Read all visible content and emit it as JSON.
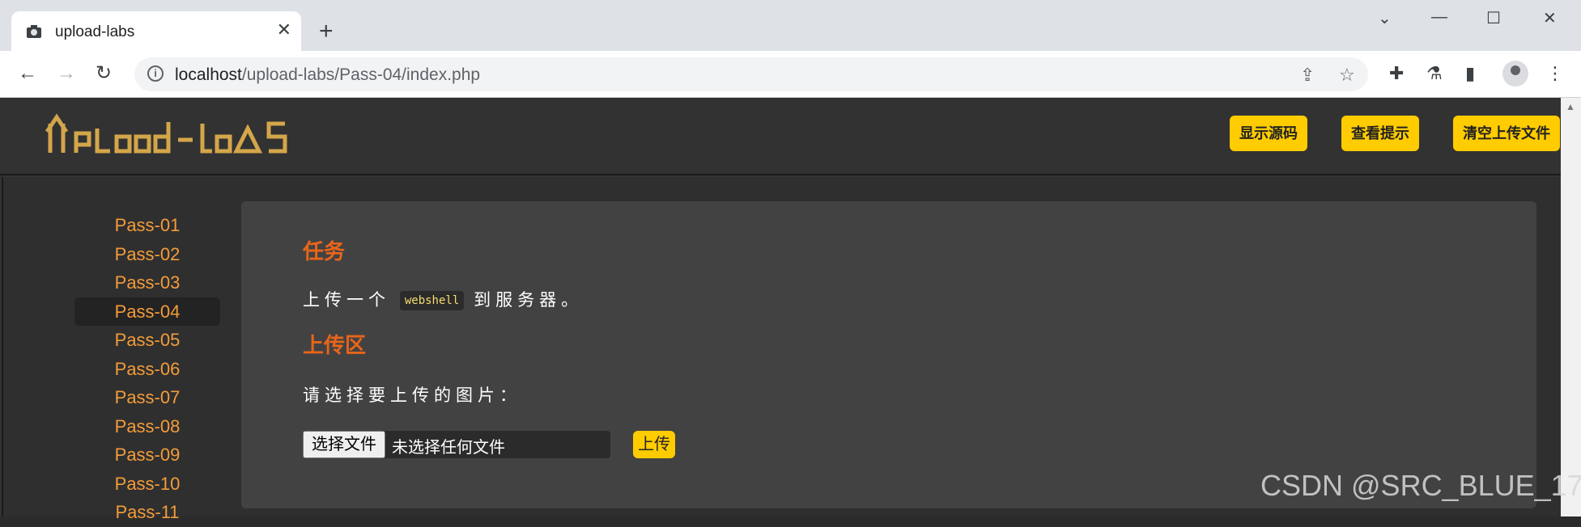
{
  "browser": {
    "tab_title": "upload-labs",
    "tab_close": "✕",
    "new_tab": "+",
    "url_host": "localhost",
    "url_path": "/upload-labs/Pass-04/index.php"
  },
  "header": {
    "logo_text": "UpLoad-LabS",
    "buttons": [
      "显示源码",
      "查看提示",
      "清空上传文件"
    ]
  },
  "sidebar": {
    "items": [
      "Pass-01",
      "Pass-02",
      "Pass-03",
      "Pass-04",
      "Pass-05",
      "Pass-06",
      "Pass-07",
      "Pass-08",
      "Pass-09",
      "Pass-10",
      "Pass-11"
    ],
    "active": "Pass-04"
  },
  "content": {
    "task_heading": "任务",
    "task_text_before": "上传一个",
    "task_code": "webshell",
    "task_text_after": "到服务器。",
    "upload_heading": "上传区",
    "upload_prompt": "请选择要上传的图片：",
    "file_button": "选择文件",
    "file_status": "未选择任何文件",
    "upload_button": "上传"
  },
  "watermark": "CSDN @SRC_BLUE_17",
  "colors": {
    "accent_orange": "#e8651a",
    "button_yellow": "#ffcc00",
    "link_orange": "#f39c3a"
  }
}
